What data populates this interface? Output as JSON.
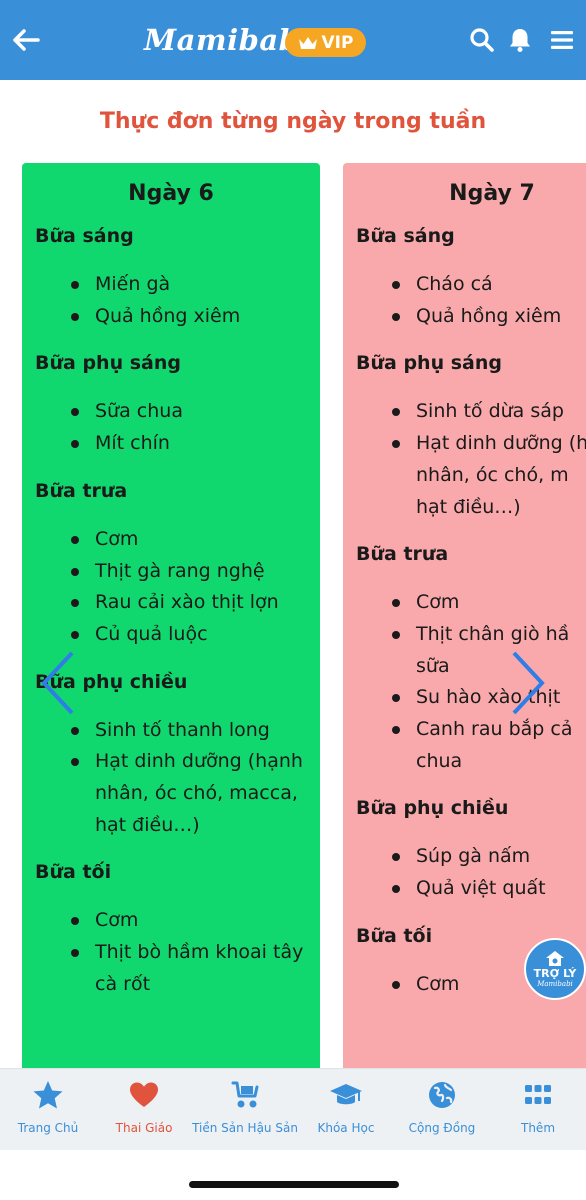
{
  "header": {
    "logo": "Mamibabi",
    "vip_label": "VIP",
    "brand_color": "#3a8fd9",
    "vip_color": "#f5a623",
    "icons": [
      "back-arrow-icon",
      "search-icon",
      "bell-icon",
      "menu-icon"
    ]
  },
  "page": {
    "title": "Thực đơn từng ngày trong tuần"
  },
  "cards": [
    {
      "title": "Ngày 6",
      "color": "#11d86e",
      "meals": [
        {
          "name": "Bữa sáng",
          "items": [
            "Miến gà",
            "Quả hồng xiêm"
          ]
        },
        {
          "name": "Bữa phụ sáng",
          "items": [
            "Sữa chua",
            "Mít chín"
          ]
        },
        {
          "name": "Bữa trưa",
          "items": [
            "Cơm",
            "Thịt gà rang nghệ",
            "Rau cải xào thịt lợn",
            "Củ quả luộc"
          ]
        },
        {
          "name": "Bữa phụ chiều",
          "items": [
            "Sinh tố thanh long",
            "Hạt dinh dưỡng (hạnh nhân, óc chó, macca, hạt điều…)"
          ]
        },
        {
          "name": "Bữa tối",
          "items": [
            "Cơm",
            "Thịt bò hầm khoai tây cà rốt"
          ]
        }
      ]
    },
    {
      "title": "Ngày 7",
      "color": "#f9a9ab",
      "meals": [
        {
          "name": "Bữa sáng",
          "items": [
            "Cháo cá",
            "Quả hồng xiêm"
          ]
        },
        {
          "name": "Bữa phụ sáng",
          "items": [
            "Sinh tố dừa sáp",
            "Hạt dinh dưỡng (hạnh",
            "nhân, óc chó, m",
            "hạt điều…)"
          ]
        },
        {
          "name": "Bữa trưa",
          "items": [
            "Cơm",
            "Thịt chân giò hầ",
            "sữa",
            "Su hào xào thịt",
            "Canh rau bắp cả",
            "chua"
          ]
        },
        {
          "name": "Bữa phụ chiều",
          "items": [
            "Súp gà nấm",
            "Quả việt quất"
          ]
        },
        {
          "name": "Bữa tối",
          "items": [
            "Cơm"
          ]
        }
      ]
    }
  ],
  "assistant": {
    "label": "TRỢ LÝ",
    "sub": "Mamibabi"
  },
  "bottom_nav": [
    {
      "label": "Trang Chủ",
      "icon": "star-icon",
      "active": false
    },
    {
      "label": "Thai Giáo",
      "icon": "heart-icon",
      "active": true
    },
    {
      "label": "Tiền Sản Hậu Sản",
      "icon": "stroller-icon",
      "active": false
    },
    {
      "label": "Khóa Học",
      "icon": "graduation-cap-icon",
      "active": false
    },
    {
      "label": "Cộng Đồng",
      "icon": "globe-icon",
      "active": false
    },
    {
      "label": "Thêm",
      "icon": "grid-icon",
      "active": false
    }
  ],
  "colors": {
    "title_red": "#e0533d",
    "nav_blue": "#3a8fd9"
  }
}
